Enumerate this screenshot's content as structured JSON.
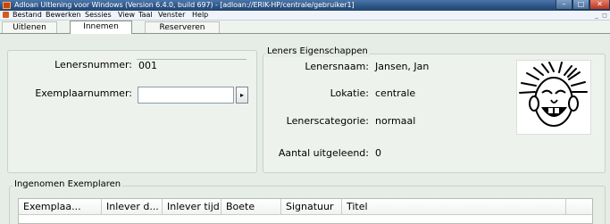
{
  "window": {
    "title": "Adloan Uitlening voor Windows (Version 6.4.0, build 697) - [adloan://ERIK-HP/centrale/gebruiker1]"
  },
  "window_controls": {
    "minimize": "–",
    "maximize": "□",
    "close": "✕"
  },
  "menu": {
    "items": [
      "Bestand",
      "Bewerken",
      "Sessies",
      "View",
      "Taal",
      "Venster",
      "Help"
    ],
    "mdi_minimize": "_",
    "mdi_restore": "◻"
  },
  "tabs": [
    {
      "label": "Uitlenen",
      "active": false
    },
    {
      "label": "Innemen",
      "active": true
    },
    {
      "label": "Reserveren",
      "active": false
    }
  ],
  "lookup": {
    "lenersnummer_label": "Lenersnummer:",
    "lenersnummer_value": "001",
    "exemplaarnummer_label": "Exemplaarnummer:",
    "exemplaarnummer_value": "",
    "browse_button": "▸"
  },
  "leners": {
    "group_title": "Leners Eigenschappen",
    "naam_label": "Lenersnaam:",
    "naam_value": "Jansen, Jan",
    "lokatie_label": "Lokatie:",
    "lokatie_value": "centrale",
    "categorie_label": "Lenerscategorie:",
    "categorie_value": "normaal",
    "uitgeleend_label": "Aantal uitgeleend:",
    "uitgeleend_value": "0"
  },
  "ingenomen": {
    "group_title": "Ingenomen Exemplaren",
    "columns": [
      "Exemplaa...",
      "Inlever d...",
      "Inlever tijd",
      "Boete",
      "Signatuur",
      "Titel"
    ]
  },
  "colors": {
    "titlebar": "#2c5487",
    "content_bg": "#e6ece6",
    "close_button": "#c0321c"
  }
}
